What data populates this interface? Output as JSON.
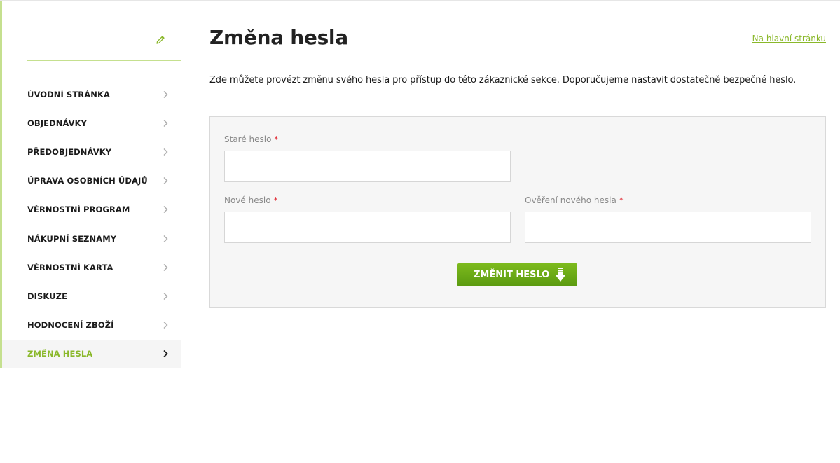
{
  "sidebar": {
    "edit_icon": "pencil-icon",
    "items": [
      {
        "label": "ÚVODNÍ STRÁNKA",
        "active": false
      },
      {
        "label": "OBJEDNÁVKY",
        "active": false
      },
      {
        "label": "PŘEDOBJEDNÁVKY",
        "active": false
      },
      {
        "label": "ÚPRAVA OSOBNÍCH ÚDAJŮ",
        "active": false
      },
      {
        "label": "VĚRNOSTNÍ PROGRAM",
        "active": false
      },
      {
        "label": "NÁKUPNÍ SEZNAMY",
        "active": false
      },
      {
        "label": "VĚRNOSTNÍ KARTA",
        "active": false
      },
      {
        "label": "DISKUZE",
        "active": false
      },
      {
        "label": "HODNOCENÍ ZBOŽÍ",
        "active": false
      },
      {
        "label": "ZMĚNA HESLA",
        "active": true
      }
    ]
  },
  "header": {
    "title": "Změna hesla",
    "home_link": "Na hlavní stránku"
  },
  "intro": "Zde můžete provézt změnu svého hesla pro přístup do této zákaznické sekce. Doporučujeme nastavit dostatečně bezpečné heslo.",
  "form": {
    "required_mark": "*",
    "old_password": {
      "label": "Staré heslo",
      "value": ""
    },
    "new_password": {
      "label": "Nové heslo",
      "value": ""
    },
    "confirm_password": {
      "label": "Ověření nového hesla",
      "value": ""
    },
    "submit_label": "ZMĚNIT HESLO"
  },
  "colors": {
    "accent": "#8ab82a",
    "button": "#6aaa16",
    "required": "#e0252f"
  }
}
